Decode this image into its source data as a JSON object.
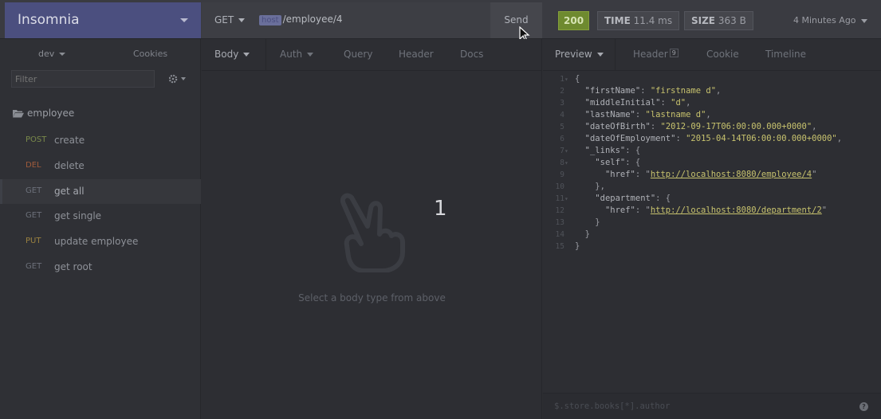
{
  "app": {
    "title": "Insomnia"
  },
  "request": {
    "method": "GET",
    "url_variable": "host",
    "url_path": "/employee/4",
    "send_label": "Send"
  },
  "response": {
    "status": "200",
    "time_label": "TIME",
    "time_value": "11.4 ms",
    "size_label": "SIZE",
    "size_value": "363 B",
    "ago": "4 Minutes Ago"
  },
  "sidebar": {
    "environment": "dev",
    "cookies_label": "Cookies",
    "filter_placeholder": "Filter",
    "folder": "employee",
    "items": [
      {
        "method": "POST",
        "name": "create",
        "cls": "post"
      },
      {
        "method": "DEL",
        "name": "delete",
        "cls": "del"
      },
      {
        "method": "GET",
        "name": "get all",
        "cls": "get"
      },
      {
        "method": "GET",
        "name": "get single",
        "cls": "get"
      },
      {
        "method": "PUT",
        "name": "update employee",
        "cls": "put"
      },
      {
        "method": "GET",
        "name": "get root",
        "cls": "get"
      }
    ]
  },
  "request_tabs": {
    "body": "Body",
    "auth": "Auth",
    "query": "Query",
    "header": "Header",
    "docs": "Docs"
  },
  "body_pane": {
    "number": "1",
    "hint": "Select a body type from above"
  },
  "response_tabs": {
    "preview": "Preview",
    "header": "Header",
    "header_count": "9",
    "cookie": "Cookie",
    "timeline": "Timeline"
  },
  "response_body": [
    {
      "n": "1",
      "fold": true,
      "parts": [
        [
          "p",
          "{"
        ]
      ]
    },
    {
      "n": "2",
      "parts": [
        [
          "p",
          "  "
        ],
        [
          "k",
          "\"firstName\""
        ],
        [
          "p",
          ": "
        ],
        [
          "s",
          "\"firstname d\""
        ],
        [
          "p",
          ","
        ]
      ]
    },
    {
      "n": "3",
      "parts": [
        [
          "p",
          "  "
        ],
        [
          "k",
          "\"middleInitial\""
        ],
        [
          "p",
          ": "
        ],
        [
          "s",
          "\"d\""
        ],
        [
          "p",
          ","
        ]
      ]
    },
    {
      "n": "4",
      "parts": [
        [
          "p",
          "  "
        ],
        [
          "k",
          "\"lastName\""
        ],
        [
          "p",
          ": "
        ],
        [
          "s",
          "\"lastname d\""
        ],
        [
          "p",
          ","
        ]
      ]
    },
    {
      "n": "5",
      "parts": [
        [
          "p",
          "  "
        ],
        [
          "k",
          "\"dateOfBirth\""
        ],
        [
          "p",
          ": "
        ],
        [
          "s",
          "\"2012-09-17T06:00:00.000+0000\""
        ],
        [
          "p",
          ","
        ]
      ]
    },
    {
      "n": "6",
      "parts": [
        [
          "p",
          "  "
        ],
        [
          "k",
          "\"dateOfEmployment\""
        ],
        [
          "p",
          ": "
        ],
        [
          "s",
          "\"2015-04-14T06:00:00.000+0000\""
        ],
        [
          "p",
          ","
        ]
      ]
    },
    {
      "n": "7",
      "fold": true,
      "parts": [
        [
          "p",
          "  "
        ],
        [
          "k",
          "\"_links\""
        ],
        [
          "p",
          ": {"
        ]
      ]
    },
    {
      "n": "8",
      "fold": true,
      "parts": [
        [
          "p",
          "    "
        ],
        [
          "k",
          "\"self\""
        ],
        [
          "p",
          ": {"
        ]
      ]
    },
    {
      "n": "9",
      "parts": [
        [
          "p",
          "      "
        ],
        [
          "k",
          "\"href\""
        ],
        [
          "p",
          ": \""
        ],
        [
          "u",
          "http://localhost:8080/employee/4"
        ],
        [
          "p",
          "\""
        ]
      ]
    },
    {
      "n": "10",
      "parts": [
        [
          "p",
          "    },"
        ]
      ]
    },
    {
      "n": "11",
      "fold": true,
      "parts": [
        [
          "p",
          "    "
        ],
        [
          "k",
          "\"department\""
        ],
        [
          "p",
          ": {"
        ]
      ]
    },
    {
      "n": "12",
      "parts": [
        [
          "p",
          "      "
        ],
        [
          "k",
          "\"href\""
        ],
        [
          "p",
          ": \""
        ],
        [
          "u",
          "http://localhost:8080/department/2"
        ],
        [
          "p",
          "\""
        ]
      ]
    },
    {
      "n": "13",
      "parts": [
        [
          "p",
          "    }"
        ]
      ]
    },
    {
      "n": "14",
      "parts": [
        [
          "p",
          "  }"
        ]
      ]
    },
    {
      "n": "15",
      "parts": [
        [
          "p",
          "}"
        ]
      ]
    }
  ],
  "query_bar": {
    "placeholder": "$.store.books[*].author",
    "help": "?"
  }
}
